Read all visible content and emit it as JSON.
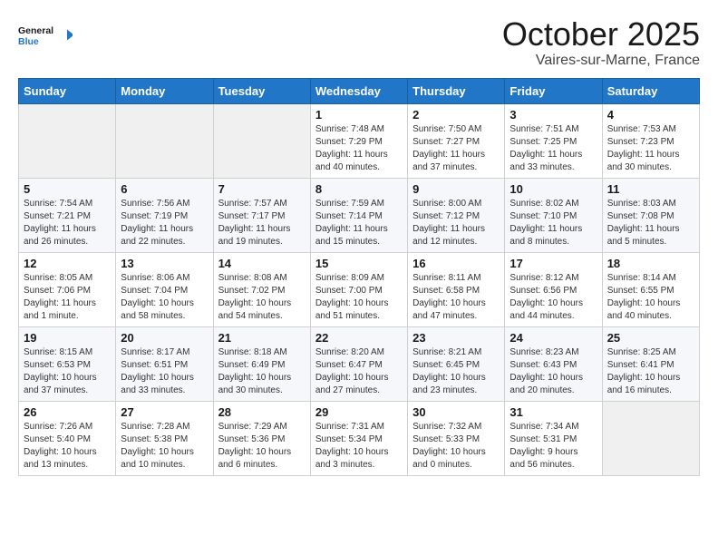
{
  "logo": {
    "text_general": "General",
    "text_blue": "Blue"
  },
  "header": {
    "month": "October 2025",
    "location": "Vaires-sur-Marne, France"
  },
  "weekdays": [
    "Sunday",
    "Monday",
    "Tuesday",
    "Wednesday",
    "Thursday",
    "Friday",
    "Saturday"
  ],
  "weeks": [
    [
      {
        "day": "",
        "info": ""
      },
      {
        "day": "",
        "info": ""
      },
      {
        "day": "",
        "info": ""
      },
      {
        "day": "1",
        "info": "Sunrise: 7:48 AM\nSunset: 7:29 PM\nDaylight: 11 hours\nand 40 minutes."
      },
      {
        "day": "2",
        "info": "Sunrise: 7:50 AM\nSunset: 7:27 PM\nDaylight: 11 hours\nand 37 minutes."
      },
      {
        "day": "3",
        "info": "Sunrise: 7:51 AM\nSunset: 7:25 PM\nDaylight: 11 hours\nand 33 minutes."
      },
      {
        "day": "4",
        "info": "Sunrise: 7:53 AM\nSunset: 7:23 PM\nDaylight: 11 hours\nand 30 minutes."
      }
    ],
    [
      {
        "day": "5",
        "info": "Sunrise: 7:54 AM\nSunset: 7:21 PM\nDaylight: 11 hours\nand 26 minutes."
      },
      {
        "day": "6",
        "info": "Sunrise: 7:56 AM\nSunset: 7:19 PM\nDaylight: 11 hours\nand 22 minutes."
      },
      {
        "day": "7",
        "info": "Sunrise: 7:57 AM\nSunset: 7:17 PM\nDaylight: 11 hours\nand 19 minutes."
      },
      {
        "day": "8",
        "info": "Sunrise: 7:59 AM\nSunset: 7:14 PM\nDaylight: 11 hours\nand 15 minutes."
      },
      {
        "day": "9",
        "info": "Sunrise: 8:00 AM\nSunset: 7:12 PM\nDaylight: 11 hours\nand 12 minutes."
      },
      {
        "day": "10",
        "info": "Sunrise: 8:02 AM\nSunset: 7:10 PM\nDaylight: 11 hours\nand 8 minutes."
      },
      {
        "day": "11",
        "info": "Sunrise: 8:03 AM\nSunset: 7:08 PM\nDaylight: 11 hours\nand 5 minutes."
      }
    ],
    [
      {
        "day": "12",
        "info": "Sunrise: 8:05 AM\nSunset: 7:06 PM\nDaylight: 11 hours\nand 1 minute."
      },
      {
        "day": "13",
        "info": "Sunrise: 8:06 AM\nSunset: 7:04 PM\nDaylight: 10 hours\nand 58 minutes."
      },
      {
        "day": "14",
        "info": "Sunrise: 8:08 AM\nSunset: 7:02 PM\nDaylight: 10 hours\nand 54 minutes."
      },
      {
        "day": "15",
        "info": "Sunrise: 8:09 AM\nSunset: 7:00 PM\nDaylight: 10 hours\nand 51 minutes."
      },
      {
        "day": "16",
        "info": "Sunrise: 8:11 AM\nSunset: 6:58 PM\nDaylight: 10 hours\nand 47 minutes."
      },
      {
        "day": "17",
        "info": "Sunrise: 8:12 AM\nSunset: 6:56 PM\nDaylight: 10 hours\nand 44 minutes."
      },
      {
        "day": "18",
        "info": "Sunrise: 8:14 AM\nSunset: 6:55 PM\nDaylight: 10 hours\nand 40 minutes."
      }
    ],
    [
      {
        "day": "19",
        "info": "Sunrise: 8:15 AM\nSunset: 6:53 PM\nDaylight: 10 hours\nand 37 minutes."
      },
      {
        "day": "20",
        "info": "Sunrise: 8:17 AM\nSunset: 6:51 PM\nDaylight: 10 hours\nand 33 minutes."
      },
      {
        "day": "21",
        "info": "Sunrise: 8:18 AM\nSunset: 6:49 PM\nDaylight: 10 hours\nand 30 minutes."
      },
      {
        "day": "22",
        "info": "Sunrise: 8:20 AM\nSunset: 6:47 PM\nDaylight: 10 hours\nand 27 minutes."
      },
      {
        "day": "23",
        "info": "Sunrise: 8:21 AM\nSunset: 6:45 PM\nDaylight: 10 hours\nand 23 minutes."
      },
      {
        "day": "24",
        "info": "Sunrise: 8:23 AM\nSunset: 6:43 PM\nDaylight: 10 hours\nand 20 minutes."
      },
      {
        "day": "25",
        "info": "Sunrise: 8:25 AM\nSunset: 6:41 PM\nDaylight: 10 hours\nand 16 minutes."
      }
    ],
    [
      {
        "day": "26",
        "info": "Sunrise: 7:26 AM\nSunset: 5:40 PM\nDaylight: 10 hours\nand 13 minutes."
      },
      {
        "day": "27",
        "info": "Sunrise: 7:28 AM\nSunset: 5:38 PM\nDaylight: 10 hours\nand 10 minutes."
      },
      {
        "day": "28",
        "info": "Sunrise: 7:29 AM\nSunset: 5:36 PM\nDaylight: 10 hours\nand 6 minutes."
      },
      {
        "day": "29",
        "info": "Sunrise: 7:31 AM\nSunset: 5:34 PM\nDaylight: 10 hours\nand 3 minutes."
      },
      {
        "day": "30",
        "info": "Sunrise: 7:32 AM\nSunset: 5:33 PM\nDaylight: 10 hours\nand 0 minutes."
      },
      {
        "day": "31",
        "info": "Sunrise: 7:34 AM\nSunset: 5:31 PM\nDaylight: 9 hours\nand 56 minutes."
      },
      {
        "day": "",
        "info": ""
      }
    ]
  ]
}
